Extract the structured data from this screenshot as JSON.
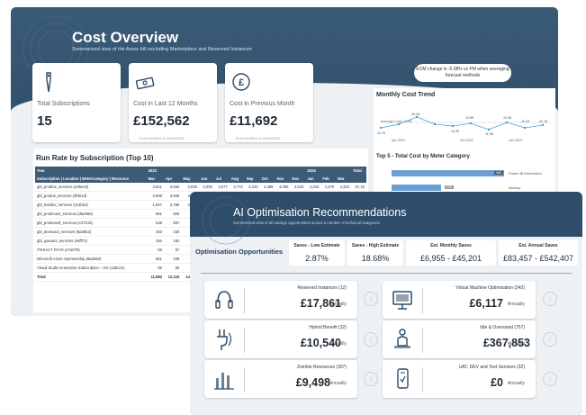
{
  "cost_overview": {
    "title": "Cost Overview",
    "subtitle": "Summarised view of the Azure bill excluding Marketplace and Reserved Instances",
    "kpis": [
      {
        "label": "Total Subscriptions",
        "value": "15",
        "note": "",
        "icon": "tag-icon"
      },
      {
        "label": "Cost in Last 12 Months",
        "value": "£152,562",
        "note": "From 01/08/23 to 31/08/2024",
        "icon": "money-icon"
      },
      {
        "label": "Cost in Previous Month",
        "value": "£11,692",
        "note": "From 01/08/24 to 31/08/2024",
        "icon": "pound-icon"
      }
    ],
    "eom_note": "EOM change is -5.08% vs PM when averaging forecast methods",
    "monthly_trend": {
      "title": "Monthly Cost Trend",
      "avg_label": "Average Cost: 12.8K",
      "point_labels": [
        "11.7K",
        "19.1K",
        "12.2K",
        "12.6K",
        "11.5K",
        "12.4K",
        "11.1K",
        "11.7K"
      ],
      "x_labels": [
        "Apr 2023",
        "Oct 2023",
        "Jan 2024"
      ]
    },
    "top5": {
      "title": "Top 5 - Total Cost by Meter Category",
      "items": [
        {
          "name": "Power BI Embedded",
          "value": "46K",
          "fraction": 0.95
        },
        {
          "name": "Backup",
          "value": "20K",
          "fraction": 0.42
        }
      ]
    },
    "run_rate": {
      "title": "Run Rate by Subscription (Top 10)",
      "year_row": [
        "Year",
        "2023",
        "2024",
        "Total"
      ],
      "header": [
        "Subscription | Location | MeterCategory | Resource",
        "Mar",
        "Apr",
        "May",
        "Jun",
        "Jul",
        "Aug",
        "Sep",
        "Oct",
        "Nov",
        "Dec",
        "Jan",
        "Feb",
        "Mar",
        ""
      ],
      "rows": [
        [
          "gbl_prodine_services (4d6ev0)",
          "3,521",
          "3,684",
          "3,030",
          "3,000",
          "4,077",
          "3,774",
          "4,222",
          "4,388",
          "4,095",
          "4,543",
          "4,344",
          "4,379",
          "4,322",
          "57,15"
        ],
        [
          "gbl_produs_services (4f801d)",
          "3,698",
          "3,656",
          "4,160",
          "4,2",
          "",
          "",
          "",
          "",
          "",
          "",
          "",
          "",
          "",
          ""
        ],
        [
          "gbl_testdev_services (4c4b53)",
          "1,947",
          "2,796",
          "2,162",
          "2,1",
          "",
          "",
          "",
          "",
          "",
          "",
          "",
          "",
          "",
          ""
        ],
        [
          "gbl_prodexact_services (dae959)",
          "691",
          "600",
          "618",
          "",
          "",
          "",
          "",
          "",
          "",
          "",
          "",
          "",
          "",
          ""
        ],
        [
          "gbl_produmell_services (e37215)",
          "548",
          "557",
          "582",
          "",
          "",
          "",
          "",
          "",
          "",
          "",
          "",
          "",
          "",
          ""
        ],
        [
          "gbl_devexact_services (8d28b2)",
          "253",
          "230",
          "250",
          "",
          "",
          "",
          "",
          "",
          "",
          "",
          "",
          "",
          "",
          ""
        ],
        [
          "gbl_qaexact_services (e8ff72)",
          "194",
          "182",
          "186",
          "",
          "",
          "",
          "",
          "",
          "",
          "",
          "",
          "",
          "",
          ""
        ],
        [
          "ITEXACT PAYG (e7a078)",
          "59",
          "57",
          "59",
          "",
          "",
          "",
          "",
          "",
          "",
          "",
          "",
          "",
          "",
          ""
        ],
        [
          "Microsoft Azure Sponsorship (8ad258)",
          "691",
          "249",
          "",
          "",
          "",
          "",
          "",
          "",
          "",
          "",
          "",
          "",
          "",
          ""
        ],
        [
          "Visual Studio Enterprise Subscription – HG (1d6c01)",
          "85",
          "90",
          "92",
          "",
          "",
          "",
          "",
          "",
          "",
          "",
          "",
          "",
          "",
          ""
        ]
      ],
      "total_row": [
        "Total",
        "11,683",
        "12,110",
        "14,139",
        "15,0",
        "",
        "",
        "",
        "",
        "",
        "",
        "",
        "",
        "",
        ""
      ]
    }
  },
  "ai_recs": {
    "title": "AI Optimisation Recommendations",
    "subtitle": "Summarised view of all savings opportunities across a number of technical categories",
    "section": "Optimisation Opportunities",
    "kpis": [
      {
        "label": "Saves - Low Estimate",
        "value": "2.87%"
      },
      {
        "label": "Saves - High Estimate",
        "value": "18.68%"
      },
      {
        "label": "Est. Monthly Saves",
        "value": "£6,955 - £45,201"
      },
      {
        "label": "Est. Annual Saves",
        "value": "£83,457 - £542,407"
      }
    ],
    "cards": [
      {
        "name": "Reserved Instances (12)",
        "amount": "£17,861",
        "period": "Annually",
        "icon": "headset-icon"
      },
      {
        "name": "Virtual Machine Optimisation (242)",
        "amount": "£6,117",
        "period": "Annually",
        "icon": "monitor-icon"
      },
      {
        "name": "Hybrid Benefit (32)",
        "amount": "£10,540",
        "period": "Annually",
        "icon": "plug-icon"
      },
      {
        "name": "Idle & Oversized (757)",
        "amount": "£367,853",
        "period": "Annually",
        "icon": "idle-person-icon"
      },
      {
        "name": "Zombie Resources (307)",
        "amount": "£9,498",
        "period": "Annually",
        "icon": "bars-icon"
      },
      {
        "name": "UAT, DEV and Test Services (32)",
        "amount": "£0",
        "period": "Annually",
        "icon": "phone-icon"
      }
    ]
  },
  "colors": {
    "header": "#2d4a66",
    "accent": "#3d8fd1",
    "panel": "#eef1f4"
  }
}
